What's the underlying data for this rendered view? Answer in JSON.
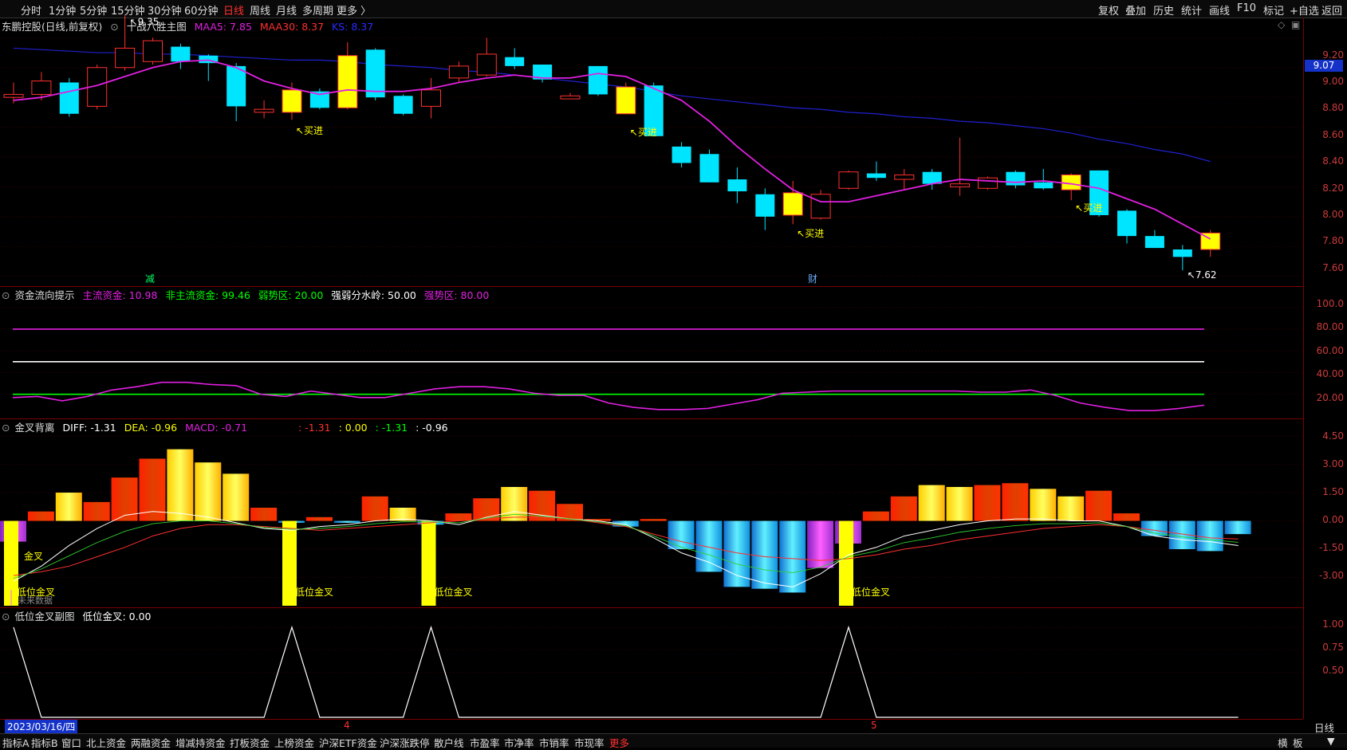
{
  "toolbar_left": [
    "分时",
    "1分钟",
    "5分钟",
    "15分钟",
    "30分钟",
    "60分钟",
    "日线",
    "周线",
    "月线",
    "多周期",
    "更多 〉"
  ],
  "toolbar_active_index": 6,
  "toolbar_right": [
    "复权",
    "叠加",
    "历史",
    "统计",
    "画线",
    "F10",
    "标记",
    "+自选",
    "返回"
  ],
  "main_title": {
    "stock": "东鹏控股(日线,前复权)",
    "indicator": "十战八胜主图",
    "maa5": "MAA5: 7.85",
    "maa30": "MAA30: 8.37",
    "ks": "KS: 8.37"
  },
  "price_axis": [
    "9.20",
    "9.00",
    "8.80",
    "8.60",
    "8.40",
    "8.20",
    "8.00",
    "7.80",
    "7.60"
  ],
  "current_price": "9.07",
  "hi_label": "9.35",
  "lo_label": "7.62",
  "buy_label": "买进",
  "event_marks": [
    "减",
    "财"
  ],
  "fund_title": {
    "name": "资金流向提示",
    "main": "主流资金: 10.98",
    "nonmain": "非主流资金: 99.46",
    "weak": "弱势区: 20.00",
    "divide": "强弱分水岭: 50.00",
    "strong": "强势区: 80.00"
  },
  "fund_axis": [
    "100.0",
    "80.00",
    "60.00",
    "40.00",
    "20.00"
  ],
  "macd_title": {
    "name": "金叉背离",
    "diff": "DIFF: -1.31",
    "dea": "DEA: -0.96",
    "macd": "MACD: -0.71",
    "v1": ": -1.31",
    "v2": ": 0.00",
    "v3": ": -1.31",
    "v4": ": -0.96"
  },
  "macd_axis": [
    "4.50",
    "3.00",
    "1.50",
    "0.00",
    "-1.50",
    "-3.00"
  ],
  "macd_labels": {
    "golden_low": "低位金叉",
    "golden_short": "金叉",
    "nodata": "未来数据"
  },
  "sub_title": {
    "name": "低位金叉副图",
    "value": "低位金叉: 0.00"
  },
  "sub_axis": [
    "1.00",
    "0.75",
    "0.50"
  ],
  "date_current": "2023/03/16/四",
  "month_marks": [
    "4",
    "5"
  ],
  "period_label": "日线",
  "bottom_tabs": [
    "指标A",
    "指标B",
    "窗口",
    "北上资金",
    "两融资金",
    "增减持资金",
    "打板资金",
    "上榜资金",
    "沪深ETF资金",
    "沪深涨跌停",
    "散户线",
    "市盈率",
    "市净率",
    "市销率",
    "市现率",
    "更多"
  ],
  "bottom_right": [
    "横",
    "板"
  ],
  "colors": {
    "up": "#ff3030",
    "down": "#00e5ff",
    "ma5": "#e020e0",
    "ma30": "#2020d0",
    "yellow": "#ffff00",
    "grid": "#7a0000"
  },
  "chart_data": [
    {
      "type": "candlestick",
      "title": "十战八胜主图",
      "ylim": [
        7.55,
        9.25
      ],
      "candles": [
        {
          "o": 8.8,
          "c": 8.82,
          "h": 8.9,
          "l": 8.76,
          "k": "up"
        },
        {
          "o": 8.82,
          "c": 8.91,
          "h": 8.97,
          "l": 8.78,
          "k": "up"
        },
        {
          "o": 8.9,
          "c": 8.69,
          "h": 8.93,
          "l": 8.67,
          "k": "down"
        },
        {
          "o": 8.74,
          "c": 9.0,
          "h": 9.02,
          "l": 8.72,
          "k": "up"
        },
        {
          "o": 9.0,
          "c": 9.13,
          "h": 9.35,
          "l": 8.98,
          "k": "up"
        },
        {
          "o": 9.04,
          "c": 9.18,
          "h": 9.2,
          "l": 9.02,
          "k": "up"
        },
        {
          "o": 9.14,
          "c": 9.04,
          "h": 9.16,
          "l": 8.99,
          "k": "down"
        },
        {
          "o": 9.08,
          "c": 9.03,
          "h": 9.09,
          "l": 8.91,
          "k": "down"
        },
        {
          "o": 9.01,
          "c": 8.74,
          "h": 9.03,
          "l": 8.64,
          "k": "down"
        },
        {
          "o": 8.72,
          "c": 8.7,
          "h": 8.78,
          "l": 8.66,
          "k": "up"
        },
        {
          "o": 8.7,
          "c": 8.85,
          "h": 8.9,
          "l": 8.65,
          "k": "yellow"
        },
        {
          "o": 8.84,
          "c": 8.73,
          "h": 8.86,
          "l": 8.72,
          "k": "down"
        },
        {
          "o": 8.73,
          "c": 9.08,
          "h": 9.17,
          "l": 8.72,
          "k": "yellow"
        },
        {
          "o": 9.12,
          "c": 8.8,
          "h": 9.13,
          "l": 8.78,
          "k": "down"
        },
        {
          "o": 8.81,
          "c": 8.69,
          "h": 8.82,
          "l": 8.68,
          "k": "down"
        },
        {
          "o": 8.74,
          "c": 8.85,
          "h": 8.93,
          "l": 8.66,
          "k": "up"
        },
        {
          "o": 8.93,
          "c": 9.01,
          "h": 9.04,
          "l": 8.9,
          "k": "up"
        },
        {
          "o": 8.95,
          "c": 9.09,
          "h": 9.2,
          "l": 8.94,
          "k": "up"
        },
        {
          "o": 9.07,
          "c": 9.01,
          "h": 9.13,
          "l": 8.99,
          "k": "down"
        },
        {
          "o": 9.02,
          "c": 8.92,
          "h": 9.02,
          "l": 8.9,
          "k": "down"
        },
        {
          "o": 8.79,
          "c": 8.81,
          "h": 8.83,
          "l": 8.79,
          "k": "up"
        },
        {
          "o": 9.01,
          "c": 8.82,
          "h": 9.01,
          "l": 8.81,
          "k": "down"
        },
        {
          "o": 8.87,
          "c": 8.69,
          "h": 8.9,
          "l": 8.69,
          "k": "yellow"
        },
        {
          "o": 8.88,
          "c": 8.54,
          "h": 8.9,
          "l": 8.54,
          "k": "down"
        },
        {
          "o": 8.47,
          "c": 8.36,
          "h": 8.5,
          "l": 8.33,
          "k": "down"
        },
        {
          "o": 8.42,
          "c": 8.23,
          "h": 8.45,
          "l": 8.23,
          "k": "down"
        },
        {
          "o": 8.25,
          "c": 8.17,
          "h": 8.33,
          "l": 8.09,
          "k": "down"
        },
        {
          "o": 8.15,
          "c": 8.0,
          "h": 8.19,
          "l": 7.91,
          "k": "down"
        },
        {
          "o": 8.01,
          "c": 8.16,
          "h": 8.24,
          "l": 7.95,
          "k": "yellow"
        },
        {
          "o": 7.99,
          "c": 8.15,
          "h": 8.18,
          "l": 7.98,
          "k": "up"
        },
        {
          "o": 8.19,
          "c": 8.3,
          "h": 8.31,
          "l": 8.18,
          "k": "up"
        },
        {
          "o": 8.29,
          "c": 8.26,
          "h": 8.37,
          "l": 8.24,
          "k": "down"
        },
        {
          "o": 8.25,
          "c": 8.28,
          "h": 8.32,
          "l": 8.18,
          "k": "up"
        },
        {
          "o": 8.3,
          "c": 8.22,
          "h": 8.32,
          "l": 8.18,
          "k": "down"
        },
        {
          "o": 8.2,
          "c": 8.22,
          "h": 8.53,
          "l": 8.14,
          "k": "up"
        },
        {
          "o": 8.19,
          "c": 8.26,
          "h": 8.27,
          "l": 8.18,
          "k": "up"
        },
        {
          "o": 8.3,
          "c": 8.21,
          "h": 8.31,
          "l": 8.19,
          "k": "down"
        },
        {
          "o": 8.23,
          "c": 8.19,
          "h": 8.32,
          "l": 8.18,
          "k": "down"
        },
        {
          "o": 8.18,
          "c": 8.28,
          "h": 8.29,
          "l": 8.11,
          "k": "yellow"
        },
        {
          "o": 8.31,
          "c": 8.01,
          "h": 8.31,
          "l": 8.0,
          "k": "down"
        },
        {
          "o": 8.04,
          "c": 7.87,
          "h": 8.05,
          "l": 7.82,
          "k": "down"
        },
        {
          "o": 7.87,
          "c": 7.79,
          "h": 7.91,
          "l": 7.79,
          "k": "down"
        },
        {
          "o": 7.78,
          "c": 7.73,
          "h": 7.81,
          "l": 7.64,
          "k": "down"
        },
        {
          "o": 7.78,
          "c": 7.89,
          "h": 7.91,
          "l": 7.73,
          "k": "yellow"
        }
      ],
      "ma5": [
        8.78,
        8.8,
        8.84,
        8.88,
        8.94,
        9.0,
        9.04,
        9.05,
        9.0,
        8.91,
        8.86,
        8.82,
        8.85,
        8.84,
        8.84,
        8.86,
        8.9,
        8.93,
        8.95,
        8.93,
        8.93,
        8.96,
        8.94,
        8.86,
        8.78,
        8.64,
        8.47,
        8.32,
        8.18,
        8.1,
        8.1,
        8.14,
        8.18,
        8.22,
        8.25,
        8.24,
        8.23,
        8.24,
        8.22,
        8.19,
        8.12,
        8.05,
        7.95,
        7.85
      ],
      "ma30": [
        9.13,
        9.12,
        9.11,
        9.1,
        9.1,
        9.09,
        9.09,
        9.08,
        9.07,
        9.06,
        9.05,
        9.05,
        9.04,
        9.02,
        9.01,
        9.0,
        8.98,
        8.97,
        8.95,
        8.93,
        8.91,
        8.89,
        8.87,
        8.84,
        8.81,
        8.79,
        8.77,
        8.75,
        8.73,
        8.72,
        8.7,
        8.69,
        8.67,
        8.66,
        8.64,
        8.63,
        8.61,
        8.59,
        8.56,
        8.52,
        8.49,
        8.45,
        8.42,
        8.37
      ]
    },
    {
      "type": "line",
      "title": "资金流向提示",
      "ylim": [
        0,
        110
      ],
      "hlines": [
        {
          "name": "强势区",
          "value": 80
        },
        {
          "name": "强弱分水岭",
          "value": 50
        },
        {
          "name": "弱势区",
          "value": 20
        }
      ],
      "series": [
        {
          "name": "主流资金",
          "values": [
            17,
            18,
            14,
            18,
            24,
            27,
            31,
            31,
            29,
            28,
            20,
            18,
            23,
            20,
            17,
            17,
            21,
            25,
            27,
            27,
            25,
            21,
            19,
            19,
            12,
            8,
            6,
            6,
            7,
            11,
            15,
            21,
            22,
            23,
            23,
            23,
            23,
            23,
            23,
            22,
            22,
            24,
            19,
            12,
            8,
            5,
            5,
            7,
            10
          ]
        }
      ]
    },
    {
      "type": "bar",
      "title": "金叉背离",
      "ylim": [
        -4.5,
        4.8
      ],
      "macd": [
        -1.1,
        0.5,
        1.5,
        1.0,
        2.3,
        3.3,
        3.8,
        3.1,
        2.5,
        0.7,
        -0.1,
        0.2,
        -0.1,
        1.3,
        0.7,
        -0.2,
        0.4,
        1.2,
        1.8,
        1.6,
        0.9,
        0.1,
        -0.3,
        0.1,
        -1.5,
        -2.7,
        -3.5,
        -3.6,
        -3.8,
        -2.5,
        -1.2,
        0.5,
        1.3,
        1.9,
        1.8,
        1.9,
        2.0,
        1.7,
        1.3,
        1.6,
        0.4,
        -0.8,
        -1.5,
        -1.6,
        -0.7
      ],
      "diff": [
        -3.2,
        -2.4,
        -1.3,
        -0.4,
        0.3,
        0.5,
        0.4,
        0.2,
        -0.1,
        -0.4,
        -0.5,
        -0.3,
        -0.2,
        0.0,
        0.1,
        0.0,
        -0.2,
        0.2,
        0.5,
        0.3,
        0.1,
        0.0,
        -0.2,
        -0.9,
        -1.7,
        -2.2,
        -2.9,
        -3.3,
        -3.5,
        -2.8,
        -1.8,
        -1.4,
        -0.8,
        -0.5,
        -0.2,
        0.0,
        0.1,
        0.1,
        0.0,
        0.0,
        -0.3,
        -0.8,
        -1.0,
        -1.1,
        -1.31
      ],
      "dea": [
        -2.9,
        -2.7,
        -2.4,
        -1.9,
        -1.4,
        -0.8,
        -0.4,
        -0.2,
        -0.2,
        -0.3,
        -0.4,
        -0.5,
        -0.4,
        -0.3,
        -0.2,
        -0.1,
        0.0,
        0.1,
        0.2,
        0.2,
        0.1,
        -0.1,
        -0.3,
        -0.7,
        -1.1,
        -1.4,
        -1.7,
        -1.9,
        -2.0,
        -2.1,
        -2.0,
        -1.8,
        -1.5,
        -1.3,
        -1.0,
        -0.8,
        -0.6,
        -0.4,
        -0.3,
        -0.2,
        -0.3,
        -0.5,
        -0.7,
        -0.9,
        -0.96
      ],
      "golden_cross_at": [
        0,
        10,
        15,
        30
      ]
    },
    {
      "type": "line",
      "title": "低位金叉副图",
      "ylim": [
        0,
        1.15
      ],
      "series": [
        {
          "name": "低位金叉",
          "values": [
            1,
            0,
            0,
            0,
            0,
            0,
            0,
            0,
            0,
            0,
            1,
            0,
            0,
            0,
            0,
            1,
            0,
            0,
            0,
            0,
            0,
            0,
            0,
            0,
            0,
            0,
            0,
            0,
            0,
            0,
            1,
            0,
            0,
            0,
            0,
            0,
            0,
            0,
            0,
            0,
            0,
            0,
            0,
            0,
            0
          ]
        }
      ]
    }
  ]
}
